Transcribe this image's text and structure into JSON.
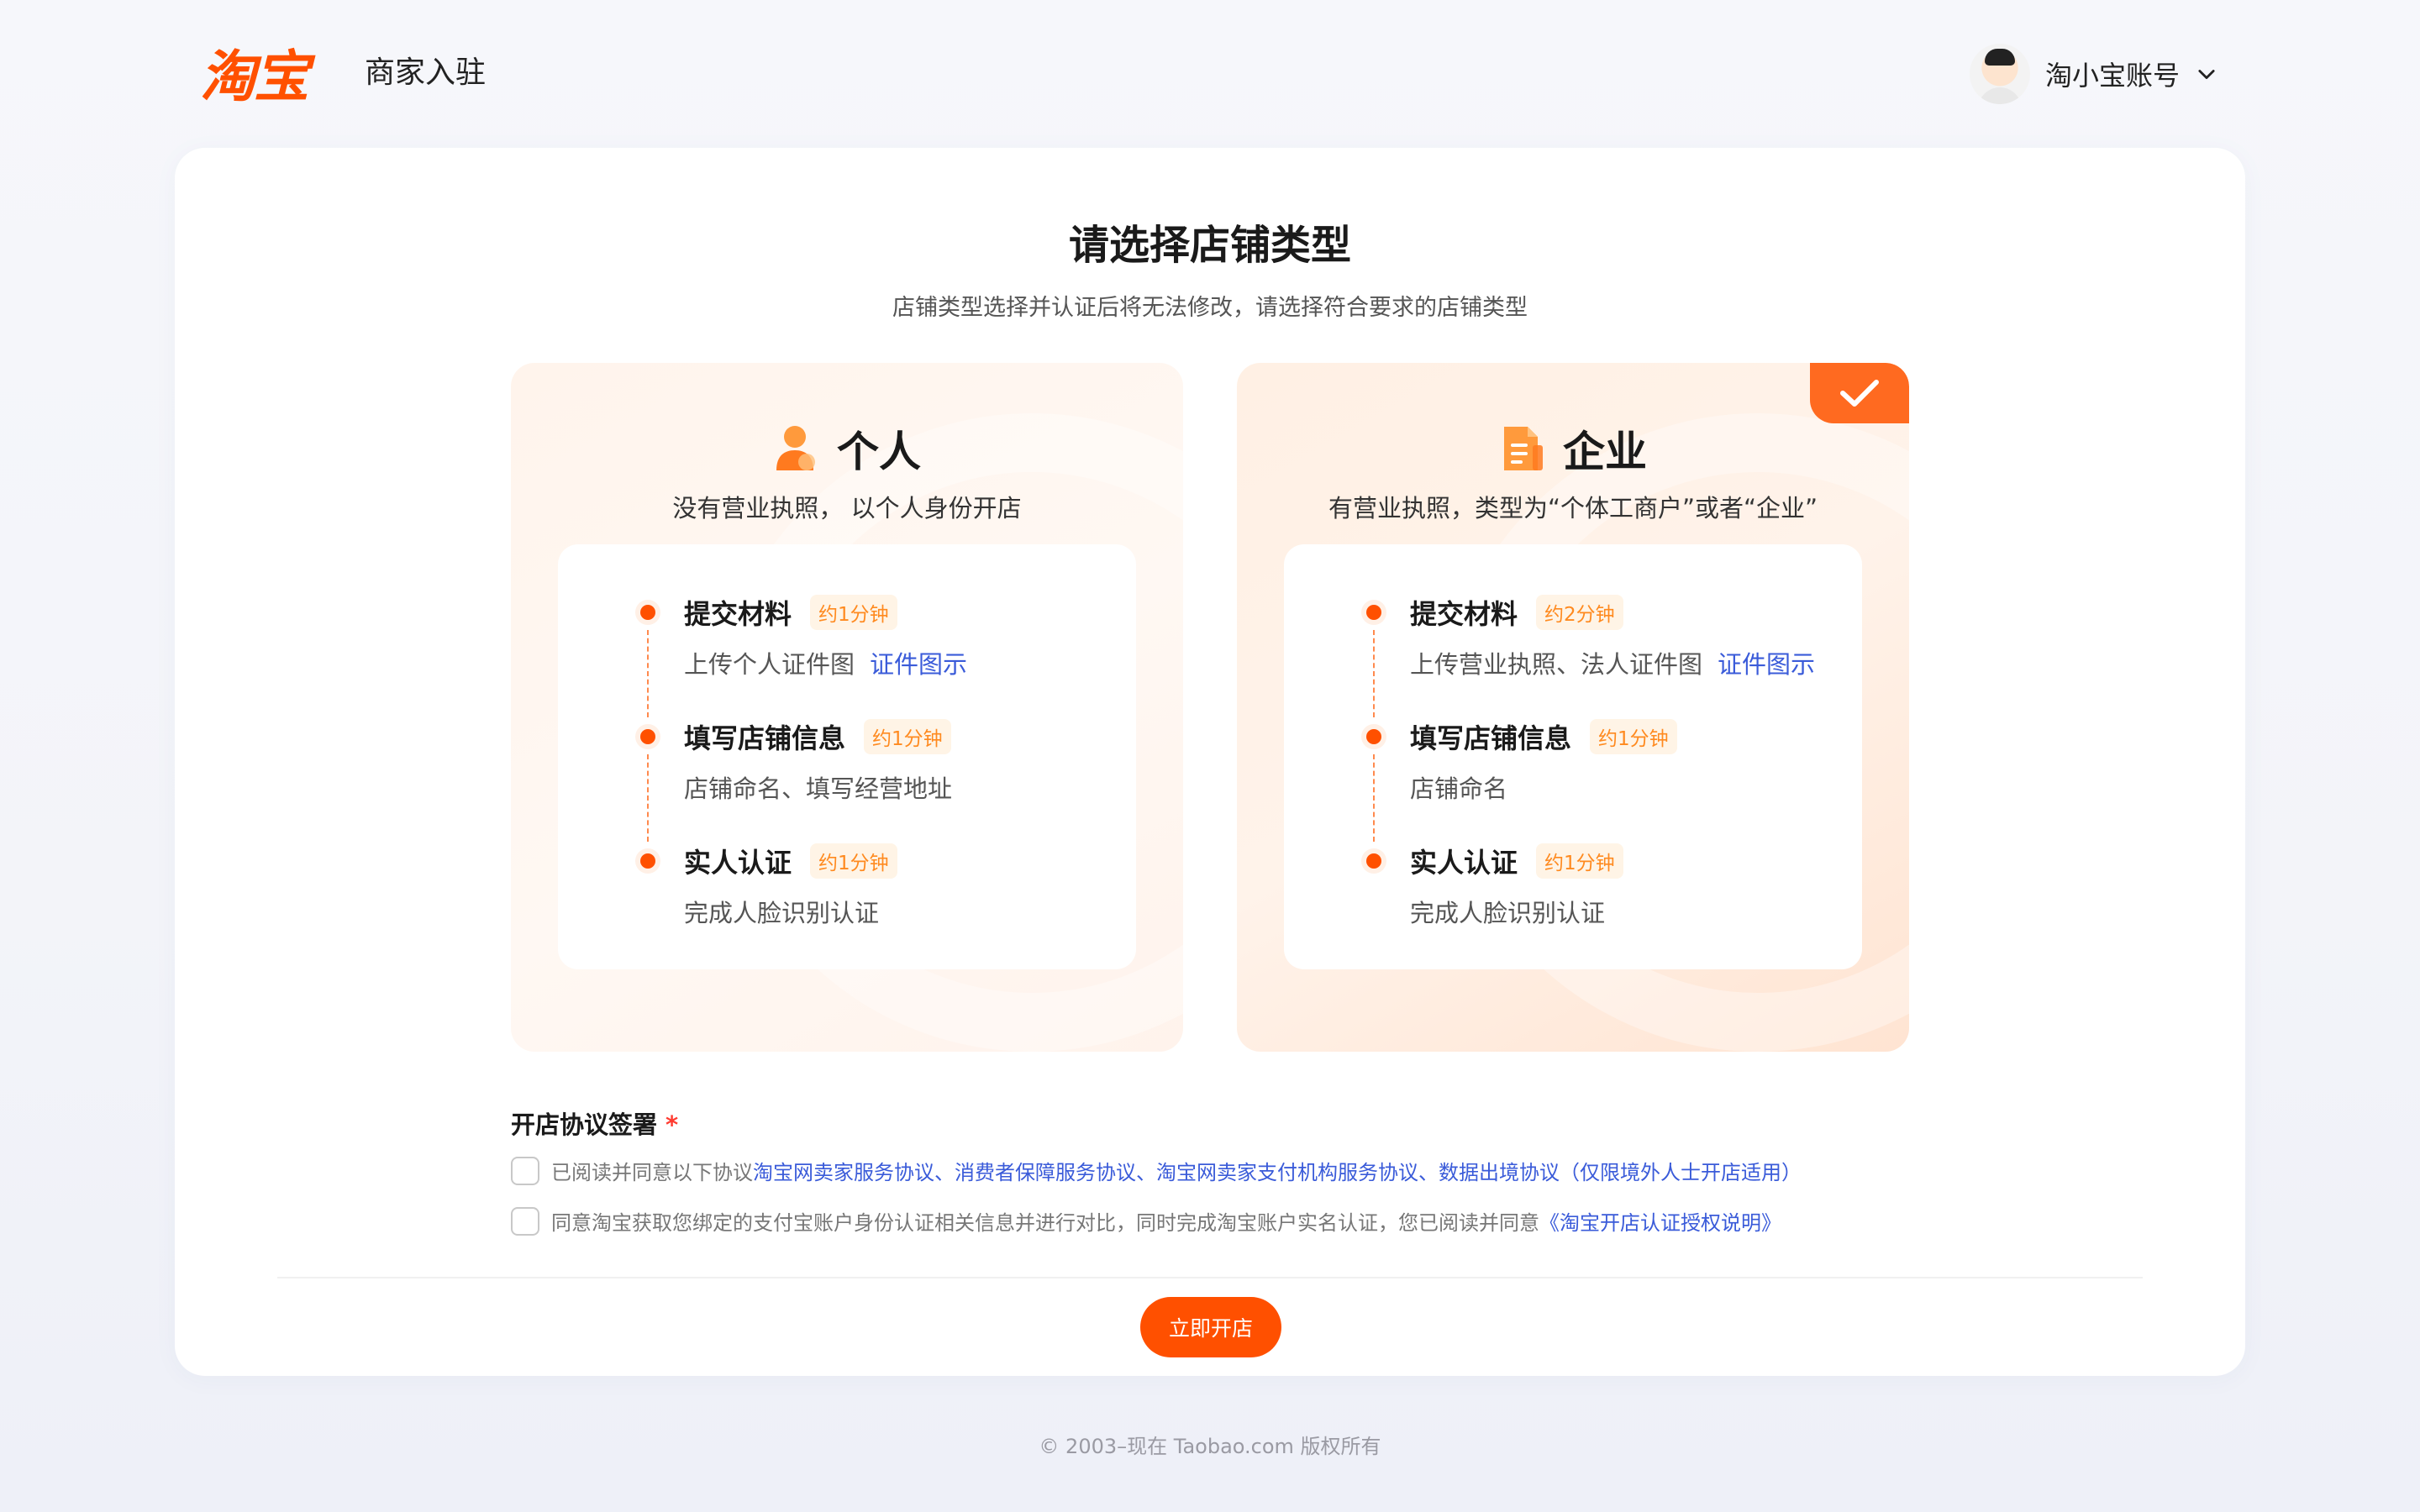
{
  "header": {
    "logo": "淘宝",
    "subtitle": "商家入驻",
    "account_name": "淘小宝账号"
  },
  "main": {
    "title": "请选择店铺类型",
    "subtitle": "店铺类型选择并认证后将无法修改，请选择符合要求的店铺类型"
  },
  "types": [
    {
      "title": "个人",
      "desc": "没有营业执照， 以个人身份开店",
      "selected": false,
      "steps": [
        {
          "title": "提交材料",
          "time": "约1分钟",
          "desc": "上传个人证件图",
          "link": "证件图示"
        },
        {
          "title": "填写店铺信息",
          "time": "约1分钟",
          "desc": "店铺命名、填写经营地址",
          "link": ""
        },
        {
          "title": "实人认证",
          "time": "约1分钟",
          "desc": "完成人脸识别认证",
          "link": ""
        }
      ]
    },
    {
      "title": "企业",
      "desc": "有营业执照，类型为“个体工商户”或者“企业”",
      "selected": true,
      "steps": [
        {
          "title": "提交材料",
          "time": "约2分钟",
          "desc": "上传营业执照、法人证件图",
          "link": "证件图示"
        },
        {
          "title": "填写店铺信息",
          "time": "约1分钟",
          "desc": "店铺命名",
          "link": ""
        },
        {
          "title": "实人认证",
          "time": "约1分钟",
          "desc": "完成人脸识别认证",
          "link": ""
        }
      ]
    }
  ],
  "agreement": {
    "title": "开店协议签署",
    "required_mark": "*",
    "row1_prefix": "已阅读并同意以下协议",
    "row1_links": "淘宝网卖家服务协议、消费者保障服务协议、淘宝网卖家支付机构服务协议、数据出境协议（仅限境外人士开店适用）",
    "row2_prefix": "同意淘宝获取您绑定的支付宝账户身份认证相关信息并进行对比，同时完成淘宝账户实名认证，您已阅读并同意",
    "row2_link": "《淘宝开店认证授权说明》"
  },
  "submit_label": "立即开店",
  "footer": "© 2003–现在 Taobao.com 版权所有",
  "colors": {
    "accent": "#ff5000",
    "link": "#3a5bd9",
    "time_badge": "#ff8a1f"
  },
  "icons": {
    "personal": "person-icon",
    "enterprise": "document-icon",
    "selected": "check-icon",
    "account_menu": "chevron-down-icon"
  }
}
